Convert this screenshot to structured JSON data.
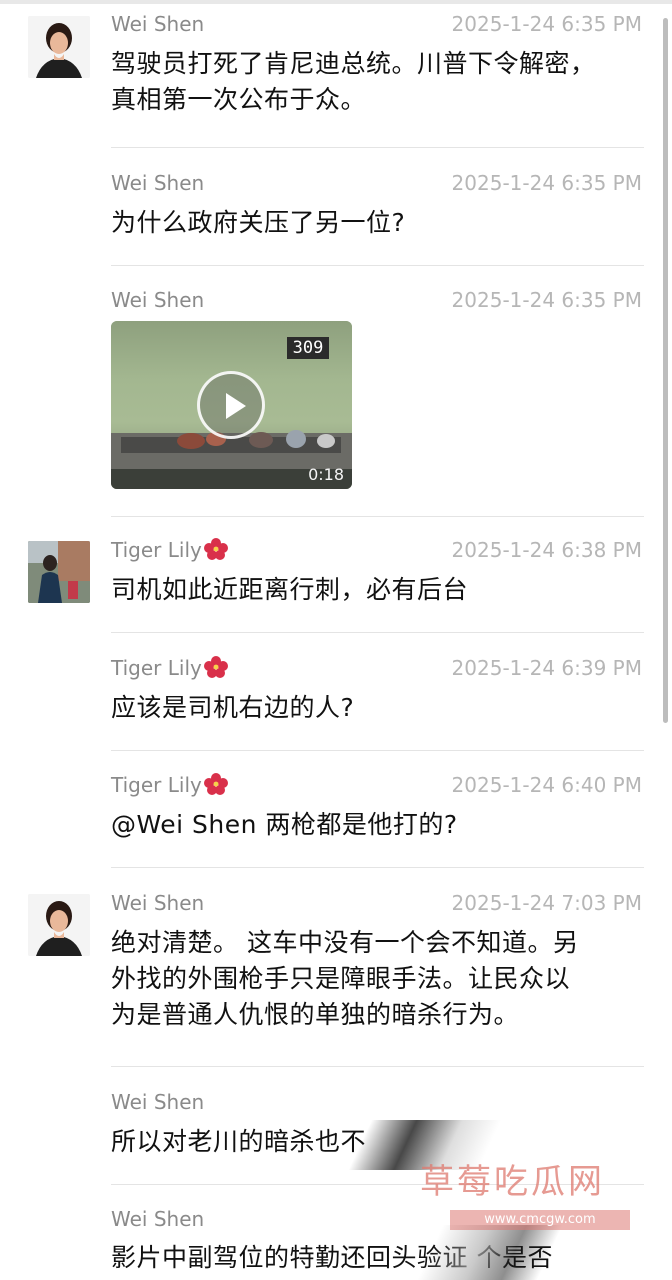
{
  "messages": [
    {
      "name": "Wei Shen",
      "time": "2025-1-24 6:35 PM",
      "lines": [
        "驾驶员打死了肯尼迪总统。川普下令解密，",
        "真相第一次公布于众。"
      ]
    },
    {
      "name": "Wei Shen",
      "time": "2025-1-24 6:35 PM",
      "lines": [
        "为什么政府关压了另一位?"
      ]
    },
    {
      "name": "Wei Shen",
      "time": "2025-1-24 6:35 PM",
      "video": {
        "counter": "309",
        "duration": "0:18"
      }
    },
    {
      "name": "Tiger Lily",
      "time": "2025-1-24 6:38 PM",
      "lines": [
        "司机如此近距离行刺，必有后台"
      ]
    },
    {
      "name": "Tiger Lily",
      "time": "2025-1-24 6:39 PM",
      "lines": [
        "应该是司机右边的人?"
      ]
    },
    {
      "name": "Tiger Lily",
      "time": "2025-1-24 6:40 PM",
      "lines": [
        "@Wei Shen 两枪都是他打的?"
      ]
    },
    {
      "name": "Wei Shen",
      "time": "2025-1-24 7:03 PM",
      "lines": [
        "绝对清楚。 这车中没有一个会不知道。另",
        "外找的外围枪手只是障眼手法。让民众以",
        "为是普通人仇恨的单独的暗杀行为。"
      ]
    },
    {
      "name": "Wei Shen",
      "time": "",
      "lines": [
        "所以对老川的暗杀也不"
      ]
    },
    {
      "name": "Wei Shen",
      "time": "",
      "lines": [
        "影片中副驾位的特勤还回头验证 个是否"
      ]
    }
  ],
  "watermark": {
    "title": "草莓吃瓜网",
    "url": "www.cmcgw.com"
  },
  "icons": {
    "flower": "hibiscus-emoji-icon",
    "play": "play-icon"
  },
  "colors": {
    "name": "#8a8a8a",
    "time": "#b6b6b6",
    "text": "#111111",
    "flower": "#d9304a"
  }
}
